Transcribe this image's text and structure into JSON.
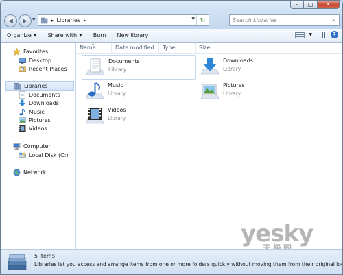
{
  "window": {
    "caption_buttons": {
      "minimize": "–",
      "maximize": "□",
      "close": "✕"
    }
  },
  "address_bar": {
    "path": "Libraries",
    "separator": "▸",
    "search_placeholder": "Search Libraries"
  },
  "toolbar": {
    "items": [
      {
        "label": "Organize",
        "has_dropdown": true
      },
      {
        "label": "Share with",
        "has_dropdown": true
      },
      {
        "label": "Burn",
        "has_dropdown": false
      },
      {
        "label": "New library",
        "has_dropdown": false
      }
    ]
  },
  "nav_pane": {
    "favorites": {
      "label": "Favorites",
      "items": [
        "Desktop",
        "Recent Places"
      ]
    },
    "libraries": {
      "label": "Libraries",
      "items": [
        "Documents",
        "Downloads",
        "Music",
        "Pictures",
        "Videos"
      ]
    },
    "computer": {
      "label": "Computer",
      "items": [
        "Local Disk (C:)"
      ]
    },
    "network": {
      "label": "Network"
    }
  },
  "columns": [
    "Name",
    "Date modified",
    "Type",
    "Size"
  ],
  "libraries": [
    {
      "name": "Documents",
      "type": "Library",
      "icon": "documents-library-icon"
    },
    {
      "name": "Downloads",
      "type": "Library",
      "icon": "downloads-library-icon"
    },
    {
      "name": "Music",
      "type": "Library",
      "icon": "music-library-icon"
    },
    {
      "name": "Pictures",
      "type": "Library",
      "icon": "pictures-library-icon"
    },
    {
      "name": "Videos",
      "type": "Library",
      "icon": "videos-library-icon"
    }
  ],
  "details": {
    "count": "5 items",
    "description": "Libraries let you access and arrange items from one or more folders quickly without moving them from their original locations."
  },
  "watermark": {
    "text": "yesky",
    "subtext": "天极网"
  }
}
